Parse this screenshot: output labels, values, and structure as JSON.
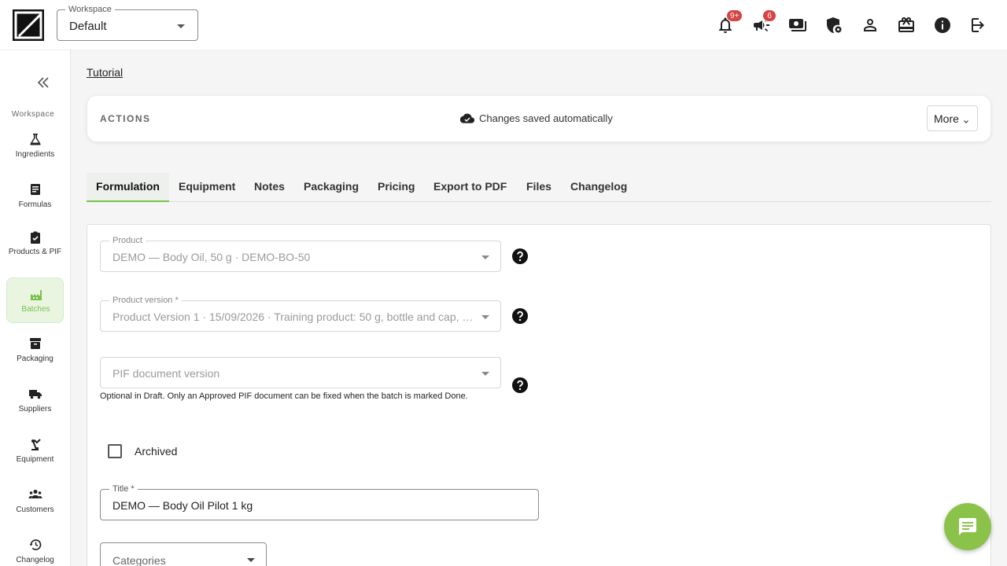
{
  "topbar": {
    "workspace_label": "Workspace",
    "workspace_value": "Default",
    "icons": [
      {
        "name": "notifications-icon",
        "badge": "9+"
      },
      {
        "name": "announcements-icon",
        "badge": "6"
      },
      {
        "name": "billing-icon"
      },
      {
        "name": "security-icon"
      },
      {
        "name": "account-icon"
      },
      {
        "name": "gift-icon"
      },
      {
        "name": "info-icon"
      },
      {
        "name": "logout-icon"
      }
    ]
  },
  "sidebar": {
    "heading": "Workspace",
    "items": [
      {
        "label": "Ingredients",
        "icon": "flask-icon"
      },
      {
        "label": "Formulas",
        "icon": "formula-icon"
      },
      {
        "label": "Products & PIF",
        "icon": "clipboard-check-icon"
      },
      {
        "label": "Batches",
        "icon": "factory-icon",
        "active": true
      },
      {
        "label": "Packaging",
        "icon": "box-icon"
      },
      {
        "label": "Suppliers",
        "icon": "truck-icon"
      },
      {
        "label": "Equipment",
        "icon": "equipment-icon"
      },
      {
        "label": "Customers",
        "icon": "people-icon"
      },
      {
        "label": "Changelog",
        "icon": "history-icon"
      }
    ]
  },
  "breadcrumb": "Tutorial",
  "actions": {
    "title": "ACTIONS",
    "status": "Changes saved automatically",
    "more_label": "More"
  },
  "tabs": [
    "Formulation",
    "Equipment",
    "Notes",
    "Packaging",
    "Pricing",
    "Export to PDF",
    "Files",
    "Changelog"
  ],
  "form": {
    "product_label": "Product",
    "product_value": "DEMO — Body Oil, 50 g · DEMO-BO-50",
    "version_label": "Product version *",
    "version_value": "Product Version 1 · 15/09/2026 · Training product: 50 g, bottle and cap, f…",
    "pif_placeholder": "PIF document version",
    "pif_hint": "Optional in Draft. Only an Approved PIF document can be fixed when the batch is marked Done.",
    "archived_label": "Archived",
    "title_label": "Title *",
    "title_value": "DEMO — Body Oil Pilot 1 kg",
    "categories_placeholder": "Categories"
  },
  "colors": {
    "accent": "#79c24a",
    "fab": "#8bc34a",
    "badge": "#d84343"
  }
}
